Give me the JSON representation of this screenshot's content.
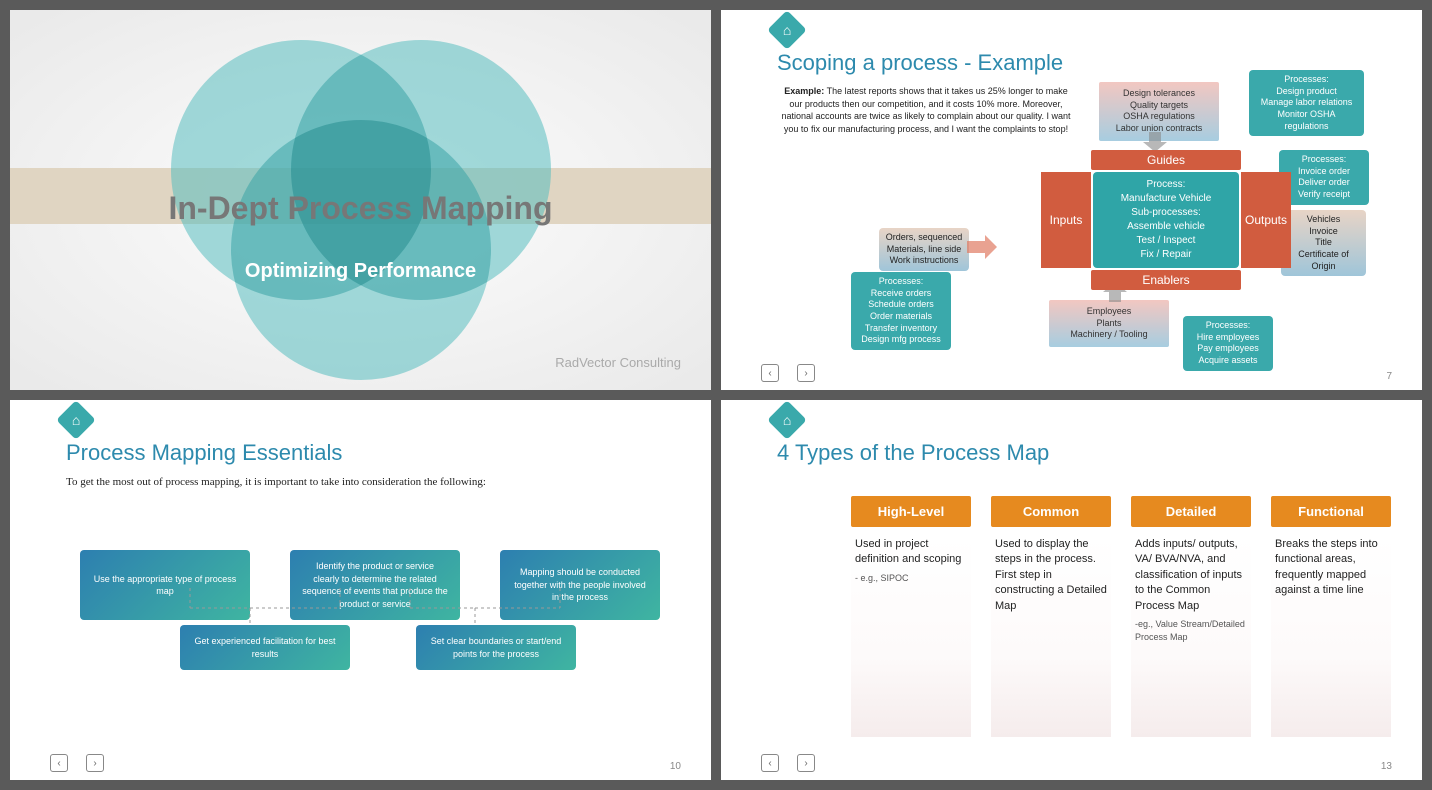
{
  "slide1": {
    "title": "In-Dept Process Mapping",
    "subtitle": "Optimizing Performance",
    "brand": "RadVector Consulting"
  },
  "slide2": {
    "page": "7",
    "title": "Scoping a process - Example",
    "example_label": "Example:",
    "example_text": "The latest reports shows that it takes us 25% longer to make our products then our competition, and it costs 10% more. Moreover, national accounts are twice as likely to complain about our quality. I want you to fix our manufacturing process, and I want the complaints to stop!",
    "guides_box": "Design  tolerances\nQuality targets\nOSHA regulations\nLabor union contracts",
    "guides_proc": "Processes:\nDesign product\nManage labor relations\nMonitor OSHA regulations",
    "guides_label": "Guides",
    "inputs_label": "Inputs",
    "outputs_label": "Outputs",
    "enablers_label": "Enablers",
    "center": "Process:\nManufacture Vehicle\nSub-processes:\nAssemble vehicle\nTest / Inspect\nFix / Repair",
    "inputs_box": "Orders, sequenced\nMaterials, line side\nWork instructions",
    "inputs_proc": "Processes:\nReceive orders\nSchedule orders\nOrder materials\nTransfer inventory\nDesign mfg process",
    "outputs_proc": "Processes:\nInvoice order\nDeliver order\nVerify receipt",
    "outputs_box": "Vehicles\nInvoice\nTitle\nCertificate of Origin",
    "enablers_box": "Employees\nPlants\nMachinery / Tooling",
    "enablers_proc": "Processes:\nHire employees\nPay employees\nAcquire assets"
  },
  "slide3": {
    "page": "10",
    "title": "Process Mapping Essentials",
    "intro": "To get the most out of process mapping, it is important to take into consideration the  following:",
    "boxes_top": [
      "Use the appropriate type of process map",
      "Identify the product or service clearly to determine the related sequence of events that  produce the product or service",
      "Mapping should be conducted together with the people involved in the process"
    ],
    "boxes_bottom": [
      "Get experienced facilitation for best results",
      "Set clear boundaries or start/end points for the process"
    ]
  },
  "slide4": {
    "page": "13",
    "title": "4 Types of the Process Map",
    "cols": [
      {
        "head": "High-Level",
        "body": "Used in project definition and scoping",
        "note": "- e.g., SIPOC"
      },
      {
        "head": "Common",
        "body": "Used to display the steps in the process.\nFirst step in constructing a Detailed Map",
        "note": ""
      },
      {
        "head": "Detailed",
        "body": "Adds inputs/ outputs, VA/ BVA/NVA, and classification of inputs to the Common Process Map",
        "note": "-eg., Value Stream/Detailed Process Map"
      },
      {
        "head": "Functional",
        "body": "Breaks the steps into functional areas, frequently mapped against a time line",
        "note": ""
      }
    ]
  },
  "home_glyph": "⌂"
}
